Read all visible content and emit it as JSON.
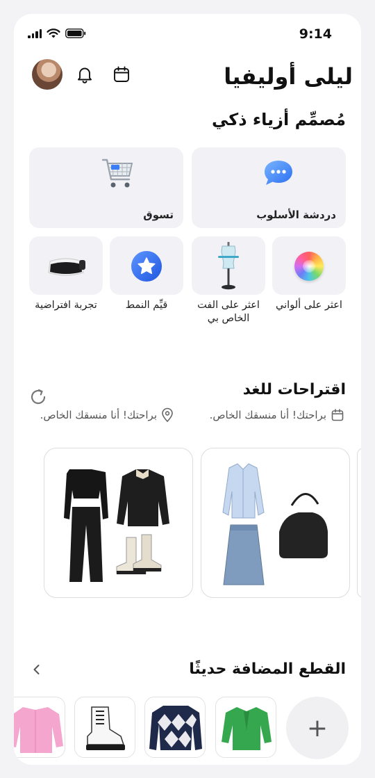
{
  "status_bar": {
    "time": "9:14"
  },
  "header": {
    "user_name": "ليلى أوليفيا"
  },
  "designer": {
    "title": "مُصمِّم أزياء ذكي",
    "tiles_large": [
      {
        "label": "دردشة الأسلوب",
        "icon": "chat-bubble-icon"
      },
      {
        "label": "تسوق",
        "icon": "shopping-cart-icon"
      }
    ],
    "tiles_small": [
      {
        "label": "اعثر على ألواني",
        "icon": "color-wheel-icon"
      },
      {
        "label": "اعثر على الفت الخاص بي",
        "icon": "mannequin-icon"
      },
      {
        "label": "قيِّم النمط",
        "icon": "star-badge-icon"
      },
      {
        "label": "تجربة افتراضية",
        "icon": "vr-headset-icon"
      }
    ]
  },
  "tomorrow": {
    "title": "اقتراحات للغد",
    "date_text": "براحتك! أنا منسقك الخاص.",
    "location_text": "براحتك! أنا منسقك الخاص."
  },
  "recent": {
    "title": "القطع المضافة حديثًا",
    "add_label": "+"
  },
  "colors": {
    "tile_bg": "#f2f2f6",
    "accent_blue": "#2f6df0",
    "text": "#111111"
  }
}
